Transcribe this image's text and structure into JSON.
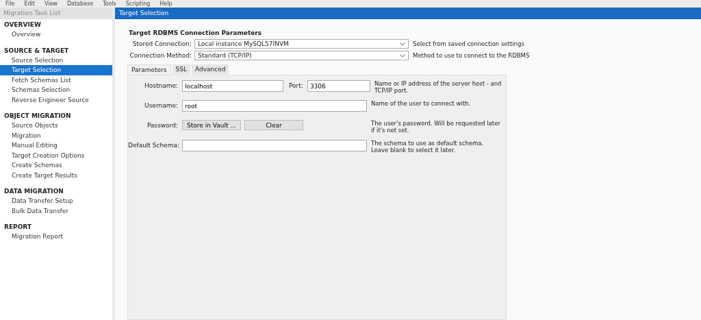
{
  "menu": [
    "File",
    "Edit",
    "View",
    "Database",
    "Tools",
    "Scripting",
    "Help"
  ],
  "sidebar": {
    "title": "Migration Task List",
    "sections": [
      {
        "heading": "OVERVIEW",
        "items": [
          {
            "label": "Overview",
            "selected": false
          }
        ]
      },
      {
        "heading": "SOURCE & TARGET",
        "items": [
          {
            "label": "Source Selection",
            "selected": false
          },
          {
            "label": "Target Selection",
            "selected": true
          },
          {
            "label": "Fetch Schemas List",
            "selected": false
          },
          {
            "label": "Schemas Selection",
            "selected": false
          },
          {
            "label": "Reverse Engineer Source",
            "selected": false
          }
        ]
      },
      {
        "heading": "OBJECT MIGRATION",
        "items": [
          {
            "label": "Source Objects",
            "selected": false
          },
          {
            "label": "Migration",
            "selected": false
          },
          {
            "label": "Manual Editing",
            "selected": false
          },
          {
            "label": "Target Creation Options",
            "selected": false
          },
          {
            "label": "Create Schemas",
            "selected": false
          },
          {
            "label": "Create Target Results",
            "selected": false
          }
        ]
      },
      {
        "heading": "DATA MIGRATION",
        "items": [
          {
            "label": "Data Transfer Setup",
            "selected": false
          },
          {
            "label": "Bulk Data Transfer",
            "selected": false
          }
        ]
      },
      {
        "heading": "REPORT",
        "items": [
          {
            "label": "Migration Report",
            "selected": false
          }
        ]
      }
    ]
  },
  "page": {
    "title": "Target Selection",
    "heading": "Target RDBMS Connection Parameters",
    "selects": [
      {
        "label": "Stored Connection:",
        "value": "Local instance MySQL57INVM",
        "hint": "Select from saved connection settings"
      },
      {
        "label": "Connection Method:",
        "value": "Standard (TCP/IP)",
        "hint": "Method to use to connect to the RDBMS"
      }
    ],
    "tabs": [
      {
        "label": "Parameters",
        "selected": true
      },
      {
        "label": "SSL",
        "selected": false
      },
      {
        "label": "Advanced",
        "selected": false
      }
    ],
    "hostname": {
      "label": "Hostname:",
      "value": "localhost",
      "port_label": "Port:",
      "port": "3306",
      "hint": "Name or IP address of the server host - and TCP/IP port."
    },
    "username": {
      "label": "Username:",
      "value": "root",
      "hint": "Name of the user to connect with."
    },
    "password": {
      "label": "Password:",
      "buttons": [
        "Store in Vault ...",
        "Clear"
      ],
      "hint": "The user's password. Will be requested later if it's not set."
    },
    "default_schema": {
      "label": "Default Schema:",
      "hint": "The schema to use as default schema. Leave blank to select it later."
    }
  }
}
